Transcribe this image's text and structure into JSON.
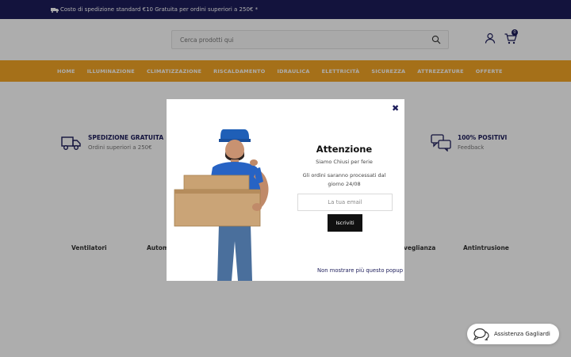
{
  "topbar": {
    "text": "Costo di spedizione standard €10 Gratuita per ordini superiori a 250€ *"
  },
  "header": {
    "search_placeholder": "Cerca prodotti qui",
    "cart_count": "0"
  },
  "nav": {
    "items": [
      "HOME",
      "ILLUMINAZIONE",
      "CLIMATIZZAZIONE",
      "RISCALDAMENTO",
      "IDRAULICA",
      "ELETTRICITÀ",
      "SICUREZZA",
      "ATTREZZATURE",
      "OFFERTE"
    ]
  },
  "features": [
    {
      "title": "SPEDIZIONE GRATUITA",
      "subtitle": "Ordini superiori a 250€"
    },
    {
      "title": "100% POSITIVI",
      "subtitle": "Feedback"
    }
  ],
  "categories": {
    "ventilatori": "Ventilatori",
    "automazione": "Autom",
    "videosorveglianza": "veglianza",
    "antintrusione": "Antintrusione"
  },
  "modal": {
    "title": "Attenzione",
    "line1": "Siamo Chiusi per ferie",
    "line2": "Gli ordini saranno processati dal giorno 24/08",
    "email_placeholder": "La tua email",
    "subscribe_label": "Iscriviti",
    "no_more_label": "Non mostrare più questo popup"
  },
  "chat": {
    "label": "Assistenza Gagliardi"
  },
  "colors": {
    "brand_navy": "#1c1c5a",
    "accent_orange": "#f3a626"
  }
}
